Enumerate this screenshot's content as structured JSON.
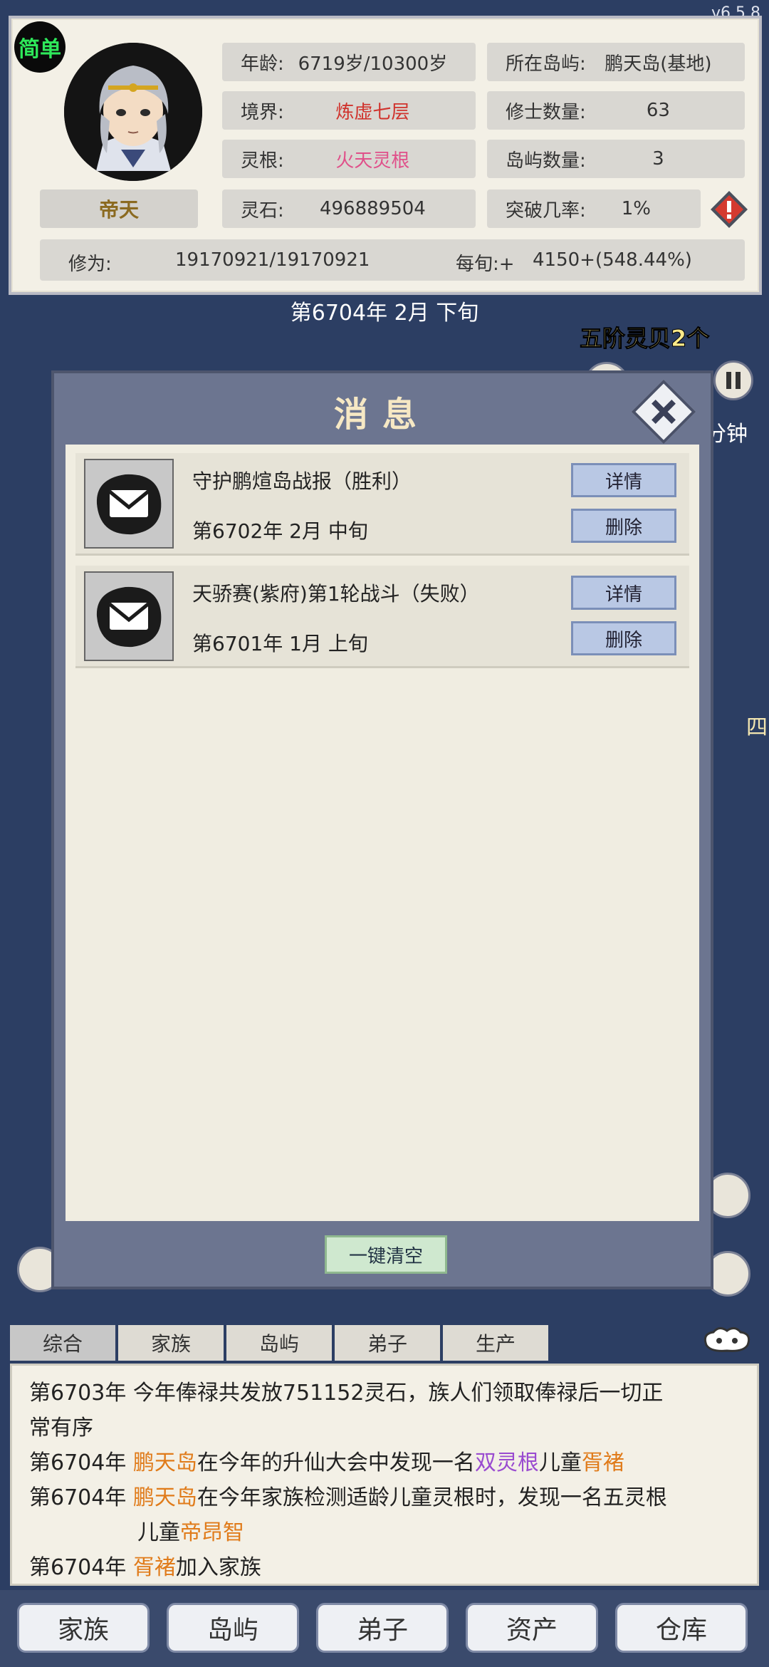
{
  "version": "v6.5.8",
  "difficulty_badge": "简单",
  "character": {
    "name": "帝天",
    "age_label": "年龄:",
    "age_value": "6719岁/10300岁",
    "island_label": "所在岛屿:",
    "island_value": "鹏天岛(基地)",
    "realm_label": "境界:",
    "realm_value": "炼虚七层",
    "disciples_label": "修士数量:",
    "disciples_value": "63",
    "spirit_root_label": "灵根:",
    "spirit_root_value": "火天灵根",
    "islands_label": "岛屿数量:",
    "islands_value": "3",
    "spirit_stones_label": "灵石:",
    "spirit_stones_value": "496889504",
    "breakthrough_label": "突破几率:",
    "breakthrough_value": "1%",
    "cultivation_label": "修为:",
    "cultivation_value": "19170921/19170921",
    "per_period_label": "每旬:+",
    "per_period_value": "4150+(548.44%)"
  },
  "current_date": "第6704年 2月 下旬",
  "background": {
    "reward_text": "五阶灵贝2个",
    "minute_text": "分钟",
    "side_text": "四"
  },
  "dialog": {
    "title": "消息",
    "messages": [
      {
        "title": "守护鹏煊岛战报（胜利）",
        "time": "第6702年 2月 中旬",
        "detail_label": "详情",
        "delete_label": "删除"
      },
      {
        "title": "天骄赛(紫府)第1轮战斗（失败）",
        "time": "第6701年 1月 上旬",
        "detail_label": "详情",
        "delete_label": "删除"
      }
    ],
    "clear_all_label": "一键清空"
  },
  "log_tabs": [
    "综合",
    "家族",
    "岛屿",
    "弟子",
    "生产"
  ],
  "log": {
    "l1_year": "第6703年",
    "l1_text": "今年俸禄共发放751152灵石，族人们领取俸禄后一切正",
    "l1_cont": "常有序",
    "l2_year": "第6704年",
    "l2_island": "鹏天岛",
    "l2_text_a": "在今年的升仙大会中发现一名",
    "l2_root": "双灵根",
    "l2_text_b": "儿童",
    "l2_child": "胥褚",
    "l3_year": "第6704年",
    "l3_island": "鹏天岛",
    "l3_text": "在今年家族检测适龄儿童灵根时，发现一名五灵根",
    "l3_cont": "儿童",
    "l3_child": "帝昂智",
    "l4_year": "第6704年",
    "l4_name": "胥褚",
    "l4_text": "加入家族"
  },
  "bottom_nav": [
    "家族",
    "岛屿",
    "弟子",
    "资产",
    "仓库"
  ],
  "colors": {
    "realm": "#d0322c",
    "spirit_root": "#e0508a",
    "highlight_name": "#e07b1a",
    "highlight_root": "#9a4bd0"
  }
}
